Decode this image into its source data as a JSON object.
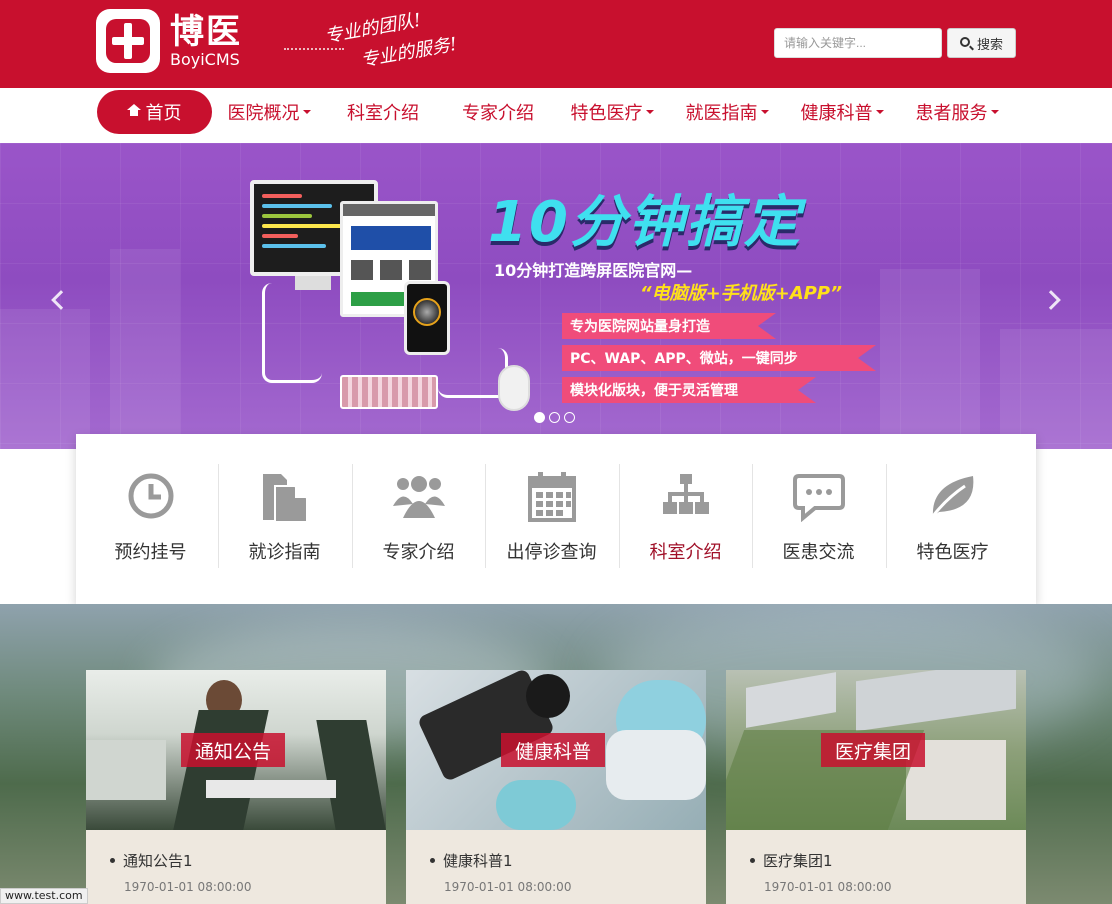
{
  "header": {
    "logo_cn": "博医",
    "logo_en": "BoyiCMS",
    "slogan_line1": "专业的团队!",
    "slogan_line2": "专业的服务!",
    "search_placeholder": "请输入关键字...",
    "search_button": "搜索",
    "brand_color": "#c8102e"
  },
  "nav": {
    "items": [
      {
        "label": "首页",
        "icon": "home-icon",
        "dropdown": false,
        "active": true
      },
      {
        "label": "医院概况",
        "dropdown": true
      },
      {
        "label": "科室介绍",
        "dropdown": false
      },
      {
        "label": "专家介绍",
        "dropdown": false
      },
      {
        "label": "特色医疗",
        "dropdown": true
      },
      {
        "label": "就医指南",
        "dropdown": true
      },
      {
        "label": "健康科普",
        "dropdown": true
      },
      {
        "label": "患者服务",
        "dropdown": true
      }
    ]
  },
  "banner": {
    "title": "10分钟搞定",
    "subtitle": "10分钟打造跨屏医院官网—",
    "highlight": "“电脑版+手机版+APP”",
    "ribbons": [
      "专为医院网站量身打造",
      "PC、WAP、APP、微站，一键同步",
      "模块化版块，便于灵活管理"
    ],
    "slide_count": 3,
    "active_slide": 1
  },
  "quick_links": [
    {
      "label": "预约挂号",
      "icon": "clock-icon"
    },
    {
      "label": "就诊指南",
      "icon": "document-icon"
    },
    {
      "label": "专家介绍",
      "icon": "users-icon"
    },
    {
      "label": "出停诊查询",
      "icon": "calendar-icon"
    },
    {
      "label": "科室介绍",
      "icon": "sitemap-icon"
    },
    {
      "label": "医患交流",
      "icon": "chat-icon"
    },
    {
      "label": "特色医疗",
      "icon": "leaf-icon"
    }
  ],
  "cards": [
    {
      "tag": "通知公告",
      "item": "通知公告1",
      "date": "1970-01-01 08:00:00"
    },
    {
      "tag": "健康科普",
      "item": "健康科普1",
      "date": "1970-01-01 08:00:00"
    },
    {
      "tag": "医疗集团",
      "item": "医疗集团1",
      "date": "1970-01-01 08:00:00"
    }
  ],
  "statusbar": {
    "text": "www.test.com"
  }
}
